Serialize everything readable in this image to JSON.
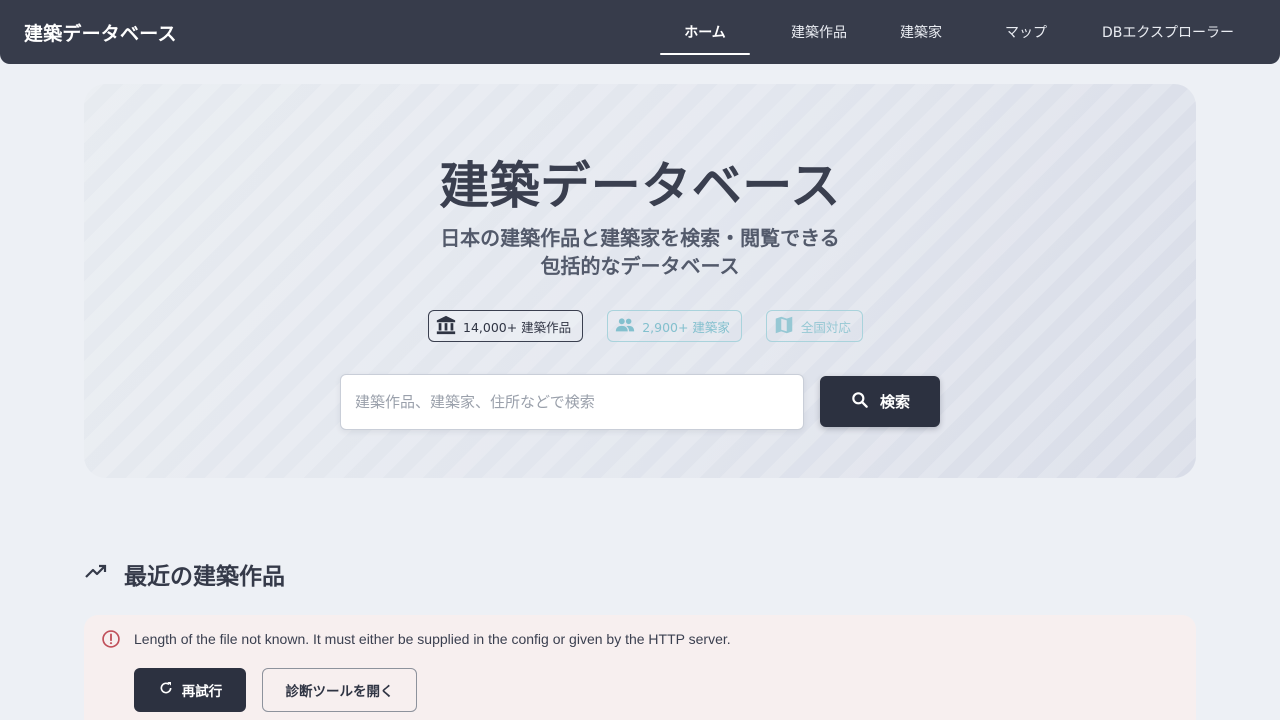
{
  "header": {
    "brand": "建築データベース",
    "nav": [
      {
        "label": "ホーム",
        "active": true
      },
      {
        "label": "建築作品",
        "active": false
      },
      {
        "label": "建築家",
        "active": false
      },
      {
        "label": "マップ",
        "active": false
      },
      {
        "label": "DBエクスプローラー",
        "active": false
      }
    ]
  },
  "hero": {
    "title": "建築データベース",
    "subtitle_line1": "日本の建築作品と建築家を検索・閲覧できる",
    "subtitle_line2": "包括的なデータベース",
    "stats": [
      {
        "icon": "building-icon",
        "label": "14,000+ 建築作品"
      },
      {
        "icon": "people-icon",
        "label": "2,900+ 建築家"
      },
      {
        "icon": "map-icon",
        "label": "全国対応"
      }
    ],
    "search": {
      "placeholder": "建築作品、建築家、住所などで検索",
      "value": "",
      "button_label": "検索"
    }
  },
  "recent": {
    "title": "最近の建築作品",
    "error": {
      "message": "Length of the file not known. It must either be supplied in the config or given by the HTTP server.",
      "retry_label": "再試行",
      "diagnostics_label": "診断ツールを開く"
    }
  },
  "colors": {
    "nav_bg": "#373c4b",
    "primary_button": "#2c3140",
    "accent_teal": "#83c0ce",
    "error_bg": "#f7efef",
    "error_icon": "#c0505a"
  }
}
